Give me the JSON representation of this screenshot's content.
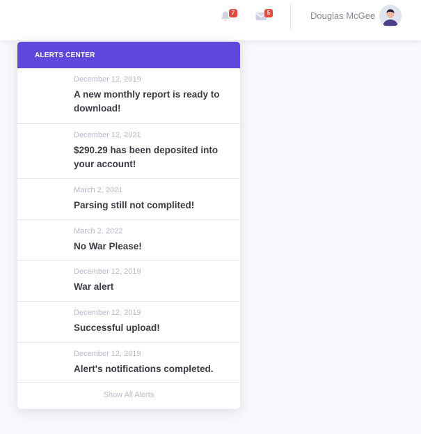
{
  "topbar": {
    "alerts_count": "7",
    "messages_count": "5",
    "user_name": "Douglas McGee"
  },
  "alerts": {
    "header": "Alerts Center",
    "items": [
      {
        "date": "December 12, 2019",
        "text": "A new monthly report is ready to download!"
      },
      {
        "date": "December 12, 2021",
        "text": "$290.29 has been deposited into your account!"
      },
      {
        "date": "March 2, 2021",
        "text": "Parsing still not complited!"
      },
      {
        "date": "March 2, 2022",
        "text": "No War Please!"
      },
      {
        "date": "December 12, 2019",
        "text": "War alert"
      },
      {
        "date": "December 12, 2019",
        "text": "Successful upload!"
      },
      {
        "date": "December 12, 2019",
        "text": "Alert's notifications completed."
      }
    ],
    "show_all": "Show All Alerts"
  },
  "colors": {
    "header_bg": "#6048dd",
    "badge": "#e74a3b",
    "text_dark": "#3a3b45",
    "text_muted": "#b7b9cc"
  }
}
